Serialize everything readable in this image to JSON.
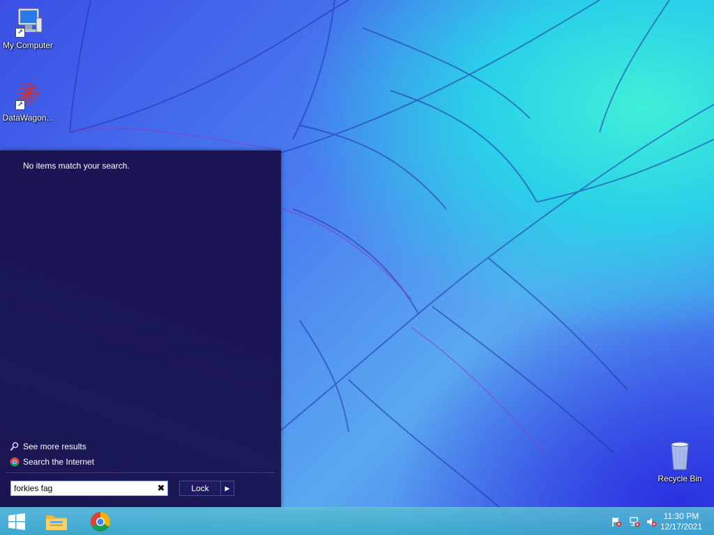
{
  "desktop": {
    "icons": [
      {
        "label": "My Computer",
        "icon": "computer-icon"
      },
      {
        "label": "DataWagon...",
        "icon": "datawagon-icon"
      },
      {
        "label": "Recycle Bin",
        "icon": "recycle-bin-icon"
      }
    ]
  },
  "start_menu": {
    "no_results_text": "No items match your search.",
    "see_more_results": "See more results",
    "search_internet": "Search the Internet",
    "search_value": "forkies fag",
    "clear_glyph": "✖",
    "lock_label": "Lock",
    "power_arrow_glyph": "▶"
  },
  "taskbar": {
    "pinned": [
      "start-button",
      "file-explorer-icon",
      "chrome-icon"
    ],
    "clock": {
      "time": "11:30 PM",
      "date": "12/17/2021"
    }
  },
  "colors": {
    "start_menu_bg": "#1a1655",
    "taskbar": "#4fb6d2"
  }
}
